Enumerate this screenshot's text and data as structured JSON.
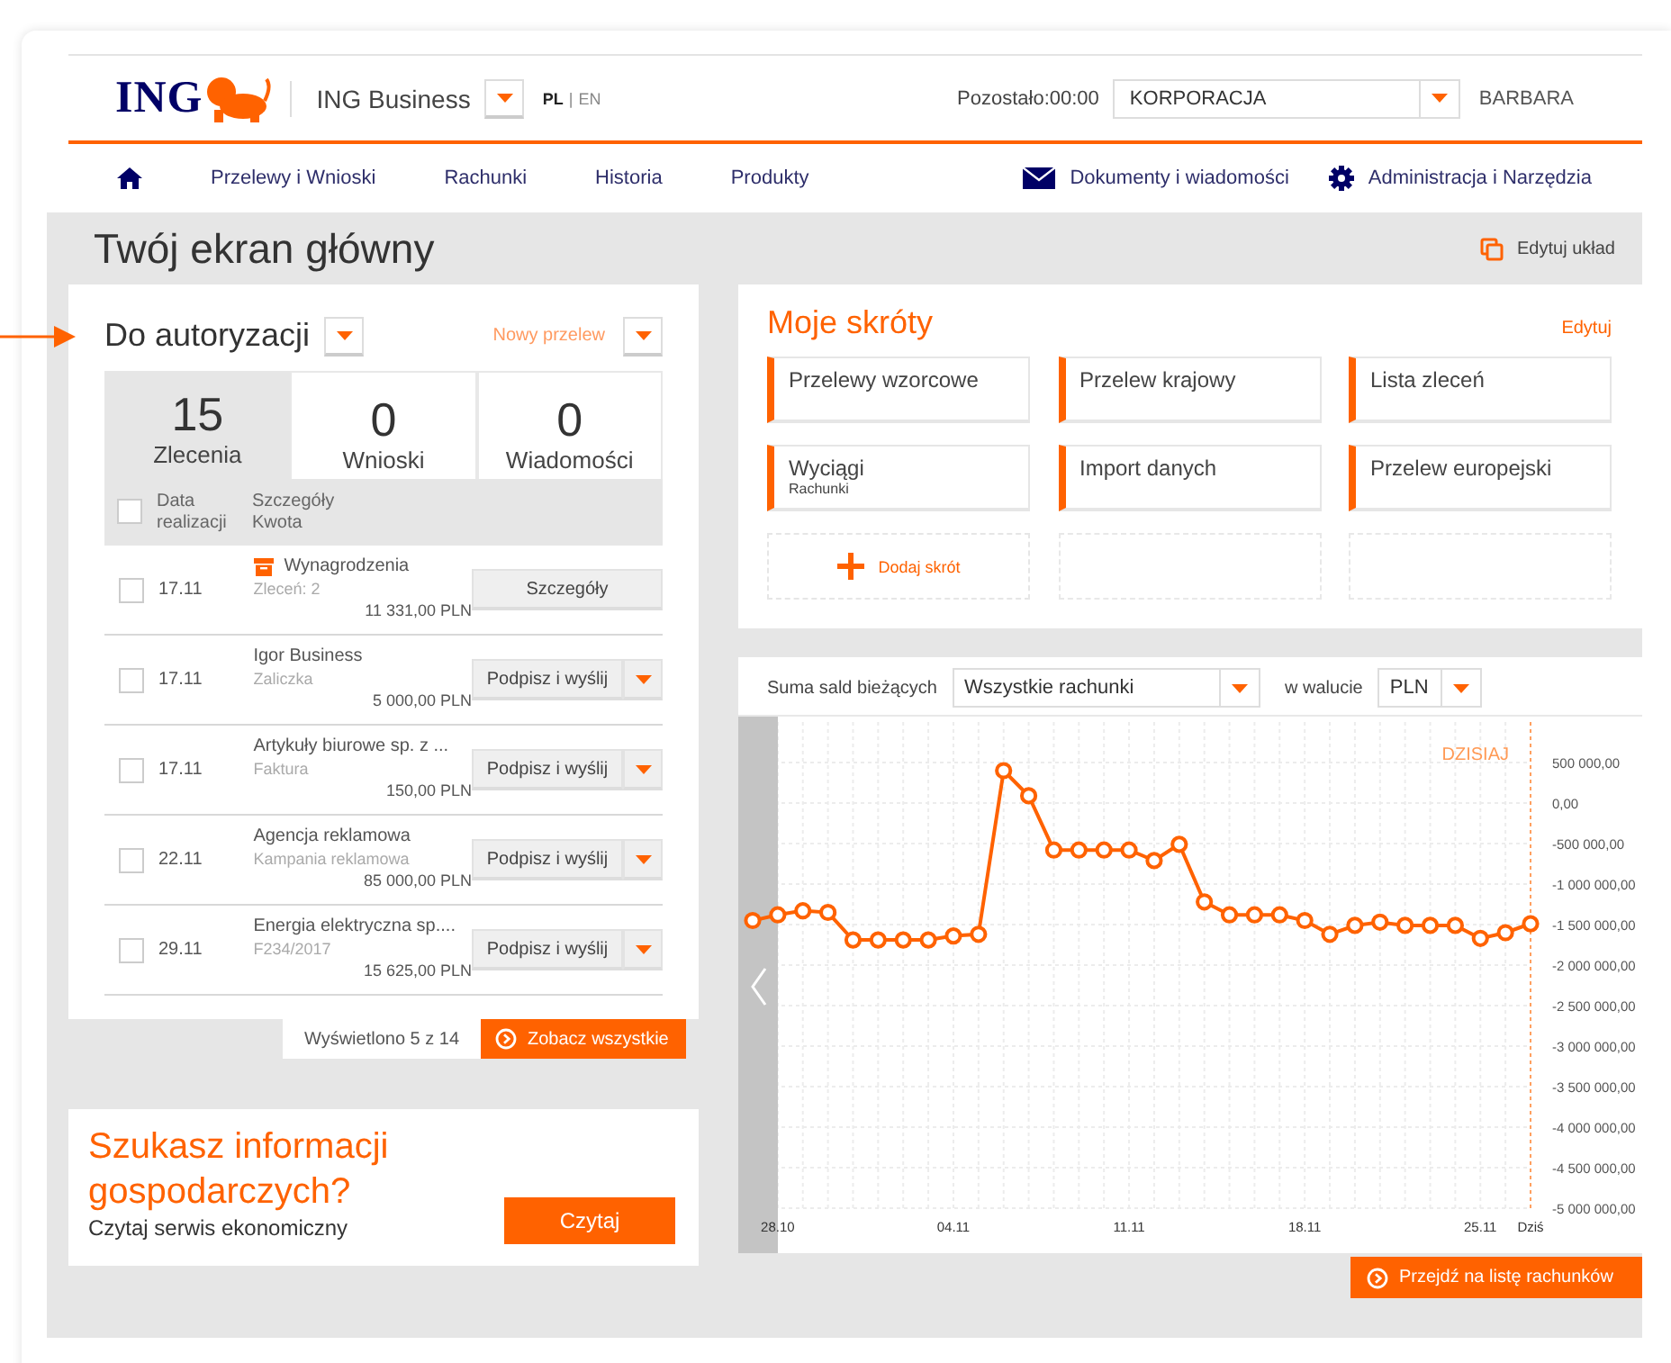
{
  "header": {
    "logo": "ING",
    "product": "ING Business",
    "languages": [
      {
        "label": "PL",
        "selected": true
      },
      {
        "label": "EN",
        "selected": false
      }
    ],
    "language_separator": "|",
    "session": "Pozostało:00:00",
    "company": "KORPORACJA",
    "user": "BARBARA"
  },
  "nav": {
    "left": [
      {
        "label": "Przelewy i Wnioski"
      },
      {
        "label": "Rachunki"
      },
      {
        "label": "Historia"
      },
      {
        "label": "Produkty"
      }
    ],
    "right": [
      {
        "label": "Dokumenty i wiadomości",
        "kind": "mail"
      },
      {
        "label": "Administracja i Narzędzia",
        "kind": "gear"
      }
    ]
  },
  "page": {
    "title": "Twój ekran główny",
    "edit_layout": "Edytuj układ"
  },
  "authorization": {
    "title": "Do autoryzacji",
    "new_transfer": "Nowy przelew",
    "tabs": [
      {
        "count": "15",
        "label": "Zlecenia",
        "selected": true
      },
      {
        "count": "0",
        "label": "Wnioski",
        "selected": false
      },
      {
        "count": "0",
        "label": "Wiadomości",
        "selected": false
      }
    ],
    "select_all_checked": false,
    "columns": [
      "Data realizacji",
      "Szczegóły",
      "Kwota"
    ],
    "rows": [
      {
        "kind": "batch",
        "checked": false,
        "date": "17.11",
        "name": "Wynagrodzenia",
        "detail": "Zleceń: 2",
        "amount": "11 331,00 PLN",
        "action": "Szczegóły"
      },
      {
        "kind": "sign",
        "checked": false,
        "date": "17.11",
        "name": "Igor Business",
        "detail": "Zaliczka",
        "amount": "5 000,00 PLN",
        "action": "Podpisz i wyślij"
      },
      {
        "kind": "sign",
        "checked": false,
        "date": "17.11",
        "name": "Artykuły biurowe sp. z ...",
        "detail": "Faktura",
        "amount": "150,00 PLN",
        "action": "Podpisz i wyślij"
      },
      {
        "kind": "sign",
        "checked": false,
        "date": "22.11",
        "name": "Agencja reklamowa",
        "detail": "Kampania reklamowa",
        "amount": "85 000,00 PLN",
        "action": "Podpisz i wyślij"
      },
      {
        "kind": "sign",
        "checked": false,
        "date": "29.11",
        "name": "Energia elektryczna sp....",
        "detail": "F234/2017",
        "amount": "15 625,00 PLN",
        "action": "Podpisz i wyślij"
      }
    ],
    "shown": "Wyświetlono 5 z 14",
    "show_all": "Zobacz wszystkie"
  },
  "promo": {
    "title": "Szukasz informacji gospodarczych?",
    "text": "Czytaj serwis ekonomiczny",
    "button": "Czytaj"
  },
  "shortcuts": {
    "title": "Moje skróty",
    "edit": "Edytuj",
    "items": [
      {
        "kind": "link",
        "label": "Przelewy wzorcowe"
      },
      {
        "kind": "link",
        "label": "Przelew krajowy"
      },
      {
        "kind": "link",
        "label": "Lista zleceń"
      },
      {
        "kind": "link",
        "label": "Wyciągi",
        "sub": "Rachunki"
      },
      {
        "kind": "link",
        "label": "Import danych"
      },
      {
        "kind": "link",
        "label": "Przelew europejski"
      },
      {
        "kind": "add",
        "label": "Dodaj skrót"
      },
      {
        "kind": "empty"
      },
      {
        "kind": "empty"
      }
    ]
  },
  "balances": {
    "label": "Suma sald bieżących",
    "account": "Wszystkie rachunki",
    "currency_label": "w walucie",
    "currency": "PLN",
    "chart_data": {
      "type": "line",
      "categories": [
        null,
        "28.10",
        null,
        null,
        null,
        null,
        null,
        null,
        "04.11",
        null,
        null,
        null,
        null,
        null,
        null,
        "11.11",
        null,
        null,
        null,
        null,
        null,
        null,
        "18.11",
        null,
        null,
        null,
        null,
        null,
        null,
        "25.11",
        null,
        "Dziś"
      ],
      "series": [
        {
          "color": "#ff6200",
          "marker": "circle",
          "values": [
            -1450000,
            -1380000,
            -1330000,
            -1350000,
            -1690000,
            -1690000,
            -1690000,
            -1690000,
            -1640000,
            -1620000,
            400000,
            90000,
            -580000,
            -580000,
            -580000,
            -580000,
            -710000,
            -510000,
            -1220000,
            -1380000,
            -1380000,
            -1380000,
            -1450000,
            -1620000,
            -1510000,
            -1470000,
            -1510000,
            -1510000,
            -1510000,
            -1670000,
            -1600000,
            -1490000
          ]
        }
      ],
      "ylim": [
        -5000000,
        1000000
      ],
      "grid": true,
      "yticks": [
        {
          "value": 500000,
          "label": "500 000,00"
        },
        {
          "value": 0,
          "label": "0,00"
        },
        {
          "value": -500000,
          "label": "-500 000,00"
        },
        {
          "value": -1000000,
          "label": "-1 000 000,00"
        },
        {
          "value": -1500000,
          "label": "-1 500 000,00"
        },
        {
          "value": -2000000,
          "label": "-2 000 000,00"
        },
        {
          "value": -2500000,
          "label": "-2 500 000,00"
        },
        {
          "value": -3000000,
          "label": "-3 000 000,00"
        },
        {
          "value": -3500000,
          "label": "-3 500 000,00"
        },
        {
          "value": -4000000,
          "label": "-4 000 000,00"
        },
        {
          "value": -4500000,
          "label": "-4 500 000,00"
        },
        {
          "value": -5000000,
          "label": "-5 000 000,00"
        }
      ],
      "annotations": [
        "DZISIAJ"
      ]
    },
    "button": "Przejdź na listę rachunków"
  }
}
